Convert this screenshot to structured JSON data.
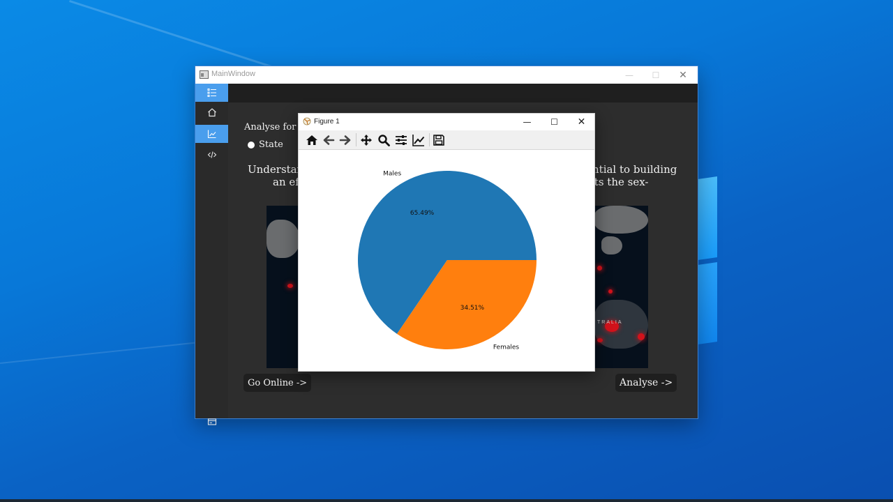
{
  "main_window": {
    "title": "MainWindow",
    "analyse_label": "Analyse for",
    "radio_label": "State",
    "paragraph": {
      "line1_left": "Understan",
      "line1_right": "ntial to building",
      "line2_left": "an eff",
      "line2_right": "its the sex-"
    },
    "map_label": "TRALIA",
    "go_online_label": "Go Online ->",
    "analyse_button_label": "Analyse ->"
  },
  "figure": {
    "title": "Figure 1",
    "toolbar": [
      "home-icon",
      "back-arrow-icon",
      "forward-arrow-icon",
      "pan-icon",
      "zoom-icon",
      "subplots-config-icon",
      "edit-axis-icon",
      "save-icon"
    ]
  },
  "colors": {
    "males": "#1f77b4",
    "females": "#ff7f0e",
    "sidebar_active": "#4a9eed"
  },
  "chart_data": {
    "type": "pie",
    "labels": [
      "Males",
      "Females"
    ],
    "values": [
      65.49,
      34.51
    ],
    "autopct_labels": [
      "65.49%",
      "34.51%"
    ],
    "colors": [
      "#1f77b4",
      "#ff7f0e"
    ],
    "title": "",
    "legend": "none"
  }
}
